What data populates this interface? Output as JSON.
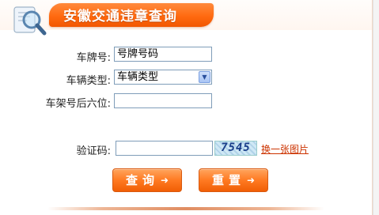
{
  "header": {
    "title": "安徽交通违章查询",
    "logo_icon": "magnifier-document-icon"
  },
  "form": {
    "plate_label": "车牌号:",
    "plate_value": "号牌号码",
    "vehicle_type_label": "车辆类型:",
    "vehicle_type_value": "车辆类型",
    "frame_no_label": "车架号后六位:",
    "frame_no_value": "",
    "captcha_label": "验证码:",
    "captcha_value": "",
    "captcha_image_text": "7545",
    "refresh_link": "换一张图片"
  },
  "buttons": {
    "query": "查询",
    "reset": "重置"
  },
  "colors": {
    "accent": "#ff6a10",
    "link": "#cc3300",
    "field_border": "#7f9db9"
  }
}
